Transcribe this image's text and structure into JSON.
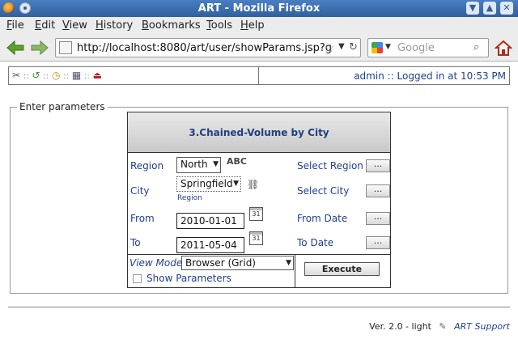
{
  "window": {
    "title": "ART - Mozilla Firefox"
  },
  "menubar": [
    "File",
    "Edit",
    "View",
    "History",
    "Bookmarks",
    "Tools",
    "Help"
  ],
  "navbar": {
    "url": "http://localhost:8080/art/user/showParams.jsp?g",
    "search_placeholder": "Google"
  },
  "art_header": {
    "tool_icons_text": ":: :: :: ::",
    "user_status": "admin :: Logged in at 10:53 PM"
  },
  "form": {
    "legend": "Enter parameters",
    "report_title": "3.Chained-Volume by City",
    "rows": [
      {
        "label": "Region",
        "value": "North",
        "hint": "Select Region",
        "badge": "ABC"
      },
      {
        "label": "City",
        "value": "Springfield",
        "hint": "Select City",
        "sub": "Region"
      },
      {
        "label": "From",
        "value": "2010-01-01",
        "hint": "From Date"
      },
      {
        "label": "To",
        "value": "2011-05-04",
        "hint": "To Date"
      }
    ],
    "view_mode_label": "View Mode",
    "view_mode_value": "Browser (Grid)",
    "show_params_label": "Show Parameters",
    "execute_label": "Execute",
    "dots_label": "...",
    "calendar_label": "31"
  },
  "footer": {
    "version": "Ver. 2.0 - light",
    "support": "ART Support"
  },
  "colors": {
    "link": "#1f3f8f",
    "titlebar": "#2f5f9e"
  }
}
